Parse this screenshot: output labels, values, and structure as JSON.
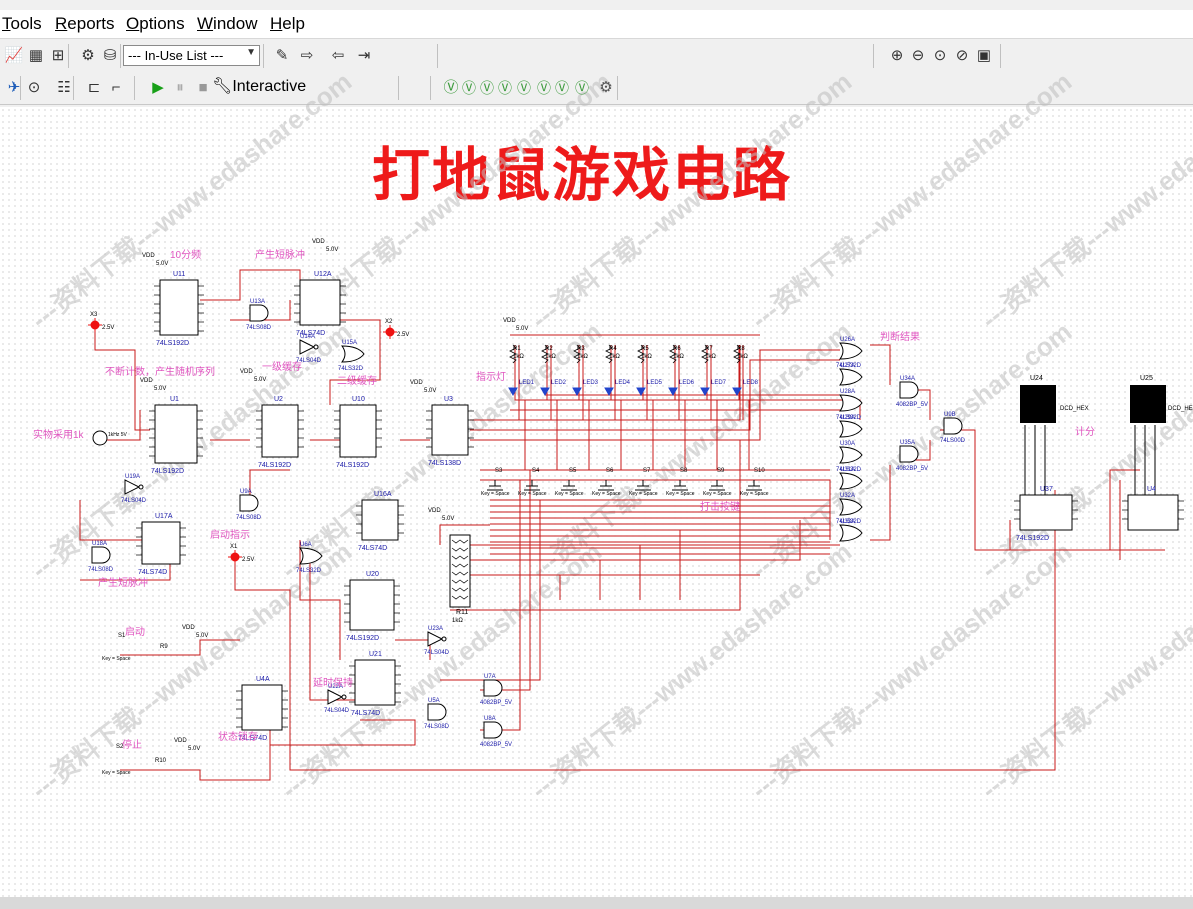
{
  "menu": {
    "items": [
      {
        "label": "Tools",
        "ul": "T",
        "rest": "ools"
      },
      {
        "label": "Reports",
        "ul": "R",
        "rest": "eports"
      },
      {
        "label": "Options",
        "ul": "O",
        "rest": "ptions"
      },
      {
        "label": "Window",
        "ul": "W",
        "rest": "indow"
      },
      {
        "label": "Help",
        "ul": "H",
        "rest": "elp"
      }
    ]
  },
  "toolbar": {
    "inuse_list": "--- In-Use List ---",
    "interactive_label": "Interactive",
    "icons": [
      "grapher-icon",
      "postprocessor-icon",
      "netlist-icon",
      "component-wizard-icon",
      "database-icon",
      "probe-icon",
      "forward-annotate-icon",
      "back-annotate-icon",
      "annotate-icon",
      "zoom-in-icon",
      "zoom-out-icon",
      "zoom-area-icon",
      "zoom-fit-icon",
      "full-screen-icon",
      "place-probe-icon",
      "clip-icon",
      "ladder-icon",
      "bus-icon",
      "wire-icon",
      "run-icon",
      "pause-icon",
      "stop-icon",
      "instrument-icon",
      "gear-icon"
    ]
  },
  "schematic": {
    "title": "打地鼠游戏电路",
    "watermark": "---资料下载---www.edashare.com",
    "labels": {
      "div10": "10分频",
      "pulse1": "产生短脉冲",
      "counter_rand": "不断计数，产生随机序列",
      "level1": "一级缓存",
      "level2": "二级缓存",
      "sample": "实物采用1k",
      "start_ind": "启动指示",
      "pulse2": "产生短脉冲",
      "start": "启动",
      "stop": "停止",
      "state_latch": "状态锁存",
      "delay": "延时保持",
      "indicator": "指示灯",
      "hit_key": "打击按键",
      "judge": "判断结果",
      "score": "计分"
    },
    "chips": [
      "U11",
      "U12A",
      "U13A",
      "U14A",
      "U15A",
      "U1",
      "U2",
      "U10",
      "U3",
      "U16A",
      "U17A",
      "U18A",
      "U19A",
      "U9A",
      "U6A",
      "U20",
      "U21",
      "U22A",
      "U23A",
      "U4A",
      "U5A",
      "U7A",
      "U8A",
      "U24",
      "U25",
      "U26A",
      "U27A",
      "U28A",
      "U29A",
      "U30A",
      "U31A",
      "U32A",
      "U33A",
      "U34A",
      "U35A",
      "U9B",
      "U37"
    ],
    "parts": {
      "74LS192D": "74LS192D",
      "74LS74D": "74LS74D",
      "74LS08D": "74LS08D",
      "74LS32D": "74LS32D",
      "74LS04D": "74LS04D",
      "74LS138D": "74LS138D",
      "4082BP_5V": "4082BP_5V",
      "74LS00D": "74LS00D",
      "DCD_HEX": "DCD_HEX"
    },
    "vdd": "VDD",
    "v5": "5.0V",
    "v25": "2.5V",
    "resistors": [
      "R1",
      "R2",
      "R3",
      "R4",
      "R5",
      "R6",
      "R7",
      "R8"
    ],
    "r_value": "1kΩ",
    "leds": [
      "LED1",
      "LED2",
      "LED3",
      "LED4",
      "LED5",
      "LED6",
      "LED7",
      "LED8"
    ],
    "switches": [
      "S3",
      "S4",
      "S5",
      "S6",
      "S7",
      "S8",
      "S9",
      "S10"
    ],
    "key_space": "Key = Space",
    "probes": [
      "X1",
      "X2",
      "X3"
    ],
    "clock": "1kHz 5V",
    "s1": "S1",
    "s2": "S2",
    "r9": "R9",
    "r10": "R10",
    "r11": "R11",
    "r11_val": "1kΩ"
  }
}
